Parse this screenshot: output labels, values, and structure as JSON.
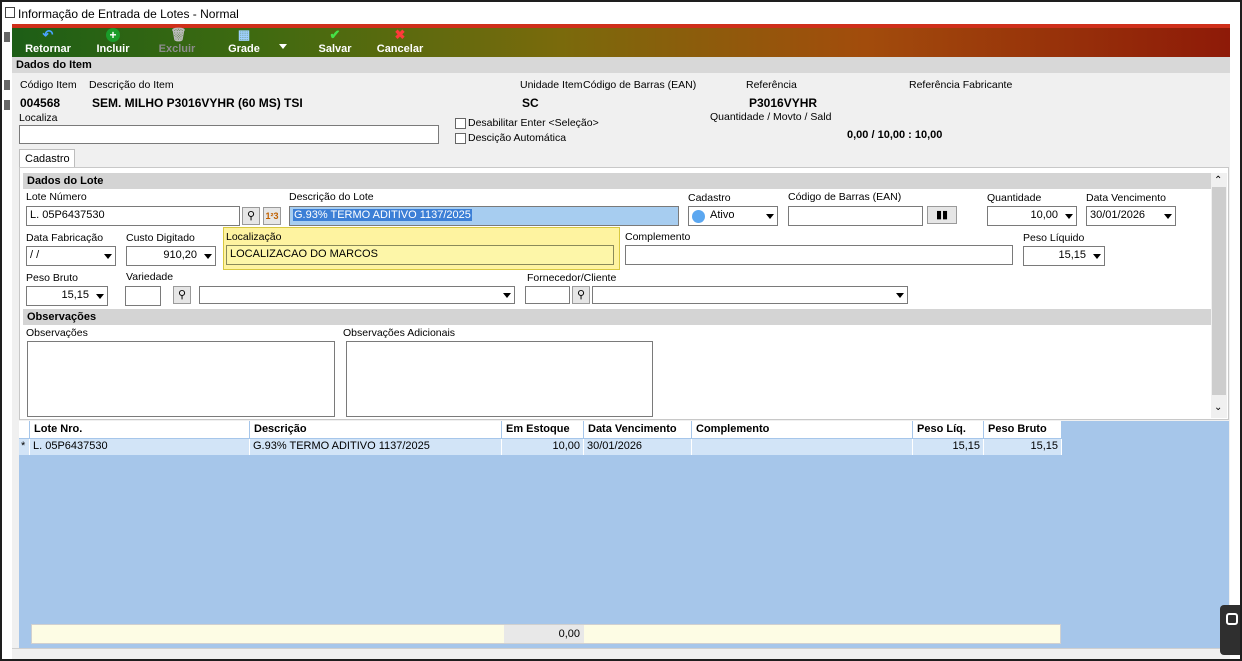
{
  "window": {
    "title": "Informação de Entrada de Lotes - Normal"
  },
  "toolbar": {
    "retornar": "Retornar",
    "incluir": "Incluir",
    "excluir": "Excluir",
    "grade": "Grade",
    "salvar": "Salvar",
    "cancelar": "Cancelar"
  },
  "item": {
    "section_title": "Dados do Item",
    "codigo_label": "Código Item",
    "codigo_value": "004568",
    "descricao_label": "Descrição do Item",
    "descricao_value": "SEM. MILHO P3016VYHR (60 MS) TSI",
    "unidade_label": "Unidade Item",
    "unidade_value": "SC",
    "ean_label": "Código de Barras (EAN)",
    "referencia_label": "Referência",
    "referencia_value": "P3016VYHR",
    "ref_fabricante_label": "Referência Fabricante",
    "localiza_label": "Localiza",
    "localiza_value": "",
    "desabilitar_label": "Desabilitar Enter <Seleção>",
    "descricao_auto_label": "Descição Automática",
    "qtd_label": "Quantidade / Movto / Sald",
    "qtd_value": "0,00 / 10,00 : 10,00"
  },
  "tabs": {
    "cadastro": "Cadastro"
  },
  "lote": {
    "section_title": "Dados do Lote",
    "numero_label": "Lote Número",
    "numero_value": "L. 05P6437530",
    "descricao_label": "Descrição do Lote",
    "descricao_value": "G.93% TERMO ADITIVO 1137/2025",
    "cadastro_label": "Cadastro",
    "cadastro_value": "Ativo",
    "ean_label": "Código de Barras (EAN)",
    "ean_value": "",
    "quantidade_label": "Quantidade",
    "quantidade_value": "10,00",
    "vencimento_label": "Data Vencimento",
    "vencimento_value": "30/01/2026",
    "fabricacao_label": "Data Fabricação",
    "fabricacao_value": " /  /",
    "custo_label": "Custo Digitado",
    "custo_value": "910,20",
    "localizacao_label": "Localização",
    "localizacao_value": "LOCALIZACAO DO MARCOS",
    "complemento_label": "Complemento",
    "complemento_value": "",
    "peso_liquido_label": "Peso Líquido",
    "peso_liquido_value": "15,15",
    "peso_bruto_label": "Peso Bruto",
    "peso_bruto_value": "15,15",
    "variedade_label": "Variedade",
    "fornecedor_label": "Fornecedor/Cliente"
  },
  "observacoes": {
    "section_title": "Observações",
    "obs_label": "Observações",
    "obs_adic_label": "Observações Adicionais"
  },
  "grid": {
    "columns": [
      "Lote Nro.",
      "Descrição",
      "Em Estoque",
      "Data Vencimento",
      "Complemento",
      "Peso Líq.",
      "Peso Bruto"
    ],
    "row": {
      "marker": "*",
      "lote": "L. 05P6437530",
      "descricao": "G.93% TERMO ADITIVO 1137/2025",
      "estoque": "10,00",
      "vencimento": "30/01/2026",
      "complemento": "",
      "peso_liq": "15,15",
      "peso_bruto": "15,15"
    },
    "footer_total": "0,00"
  }
}
